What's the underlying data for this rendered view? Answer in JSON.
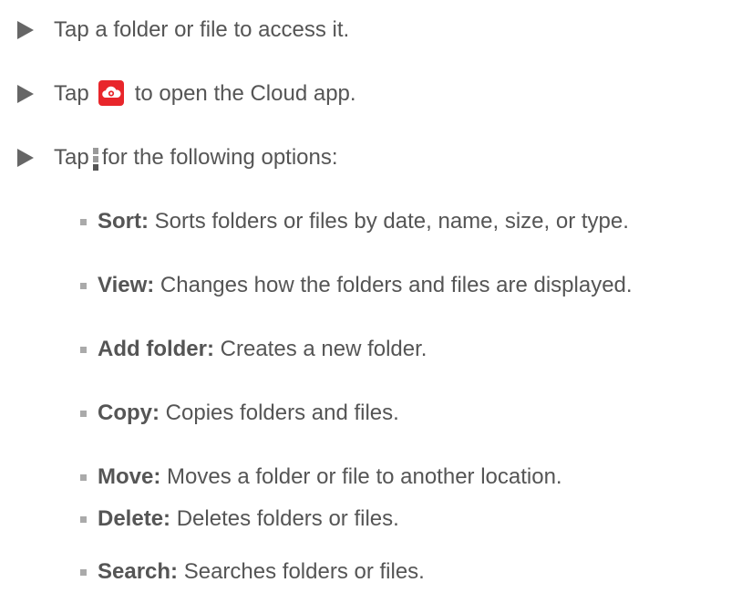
{
  "colors": {
    "text": "#555555",
    "arrow": "#666666",
    "bullet": "#aaaaaa",
    "cloud_icon_bg": "#e8262b",
    "menu_icon_top": "#9a9a9a",
    "menu_icon_bottom": "#555555"
  },
  "steps": [
    {
      "text": "Tap a folder or file to access it."
    },
    {
      "before": "Tap",
      "icon": "cloud-app-icon",
      "after": "to open the Cloud app."
    },
    {
      "before": "Tap",
      "icon": "menu-icon",
      "after": "for the following options:"
    }
  ],
  "options": [
    {
      "label": "Sort:",
      "desc": "Sorts folders or files by date, name, size, or type."
    },
    {
      "label": "View:",
      "desc": "Changes how the folders and files are displayed."
    },
    {
      "label": "Add folder:",
      "desc": "Creates a new folder."
    },
    {
      "label": "Copy:",
      "desc": "Copies folders and files."
    },
    {
      "label": "Move:",
      "desc": "Moves a folder or file to another location."
    },
    {
      "label": "Delete:",
      "desc": "Deletes folders or files."
    },
    {
      "label": "Search:",
      "desc": "Searches folders or files."
    }
  ]
}
